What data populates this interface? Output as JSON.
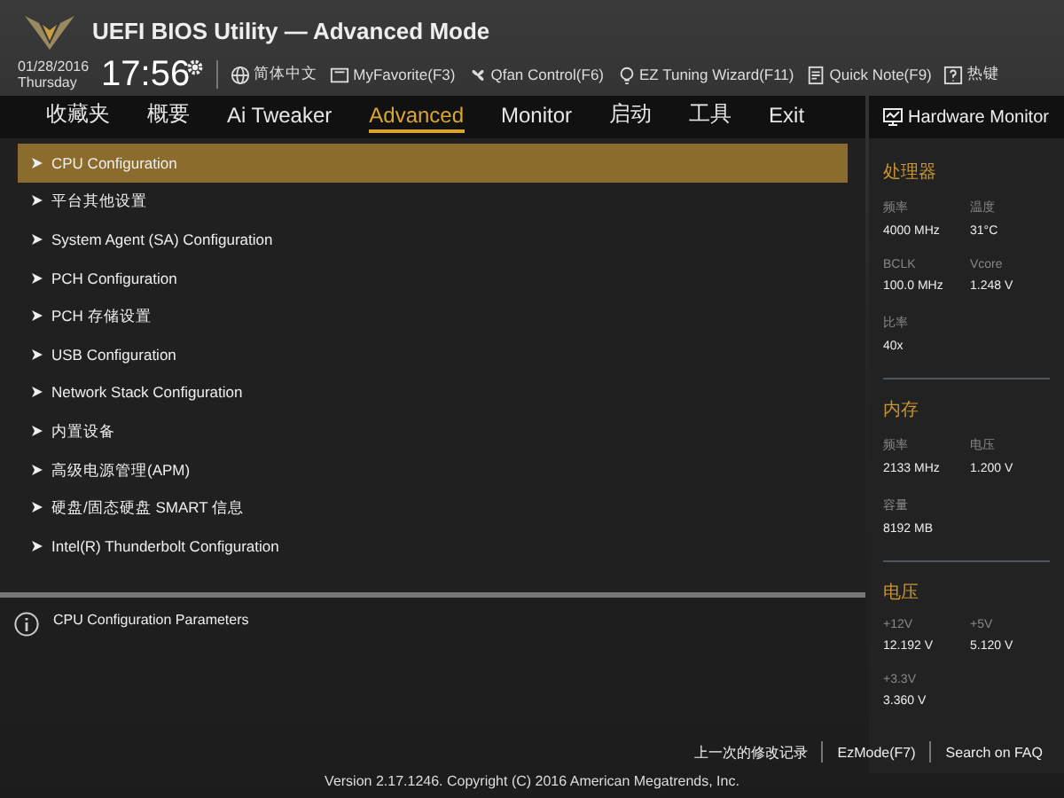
{
  "window": {
    "title": "UEFI BIOS Utility — Advanced Mode"
  },
  "clock": {
    "date": "01/28/2016",
    "day": "Thursday",
    "time": "17:56"
  },
  "toolbar": [
    {
      "label": "简体中文",
      "kind": "language"
    },
    {
      "label": "MyFavorite(F3)",
      "kind": "favorite"
    },
    {
      "label": "Qfan Control(F6)",
      "kind": "fan"
    },
    {
      "label": "EZ Tuning Wizard(F11)",
      "kind": "wizard"
    },
    {
      "label": "Quick Note(F9)",
      "kind": "note"
    },
    {
      "label": "热键",
      "kind": "hotkey"
    }
  ],
  "tabs": [
    {
      "label": "收藏夹",
      "selected": false
    },
    {
      "label": "概要",
      "selected": false
    },
    {
      "label": "Ai Tweaker",
      "selected": false
    },
    {
      "label": "Advanced",
      "selected": true
    },
    {
      "label": "Monitor",
      "selected": false
    },
    {
      "label": "启动",
      "selected": false
    },
    {
      "label": "工具",
      "selected": false
    },
    {
      "label": "Exit",
      "selected": false
    }
  ],
  "menu_items": [
    {
      "label": "CPU Configuration",
      "selected": true
    },
    {
      "label": "平台其他设置",
      "selected": false
    },
    {
      "label": "System Agent (SA) Configuration",
      "selected": false
    },
    {
      "label": "PCH Configuration",
      "selected": false
    },
    {
      "label": "PCH 存储设置",
      "selected": false
    },
    {
      "label": "USB Configuration",
      "selected": false
    },
    {
      "label": "Network Stack Configuration",
      "selected": false
    },
    {
      "label": "内置设备",
      "selected": false
    },
    {
      "label": "高级电源管理(APM)",
      "selected": false
    },
    {
      "label": "硬盘/固态硬盘 SMART 信息",
      "selected": false
    },
    {
      "label": "Intel(R) Thunderbolt Configuration",
      "selected": false
    }
  ],
  "help_text": "CPU Configuration Parameters",
  "hardware_monitor": {
    "title": "Hardware Monitor",
    "sections": [
      {
        "title": "处理器",
        "readings": [
          {
            "label": "频率",
            "value": "4000 MHz"
          },
          {
            "label": "温度",
            "value": "31°C"
          },
          {
            "label": "BCLK",
            "value": "100.0 MHz"
          },
          {
            "label": "Vcore",
            "value": "1.248 V"
          },
          {
            "label": "比率",
            "value": "40x"
          }
        ]
      },
      {
        "title": "内存",
        "readings": [
          {
            "label": "频率",
            "value": "2133 MHz"
          },
          {
            "label": "电压",
            "value": "1.200 V"
          },
          {
            "label": "容量",
            "value": "8192 MB"
          }
        ]
      },
      {
        "title": "电压",
        "readings": [
          {
            "label": "+12V",
            "value": "12.192 V"
          },
          {
            "label": "+5V",
            "value": "5.120 V"
          },
          {
            "label": "+3.3V",
            "value": "3.360 V"
          }
        ]
      }
    ]
  },
  "footer": {
    "links": [
      "上一次的修改记录",
      "EzMode(F7)",
      "Search on FAQ"
    ],
    "version": "Version 2.17.1246. Copyright (C) 2016 American Megatrends, Inc."
  }
}
